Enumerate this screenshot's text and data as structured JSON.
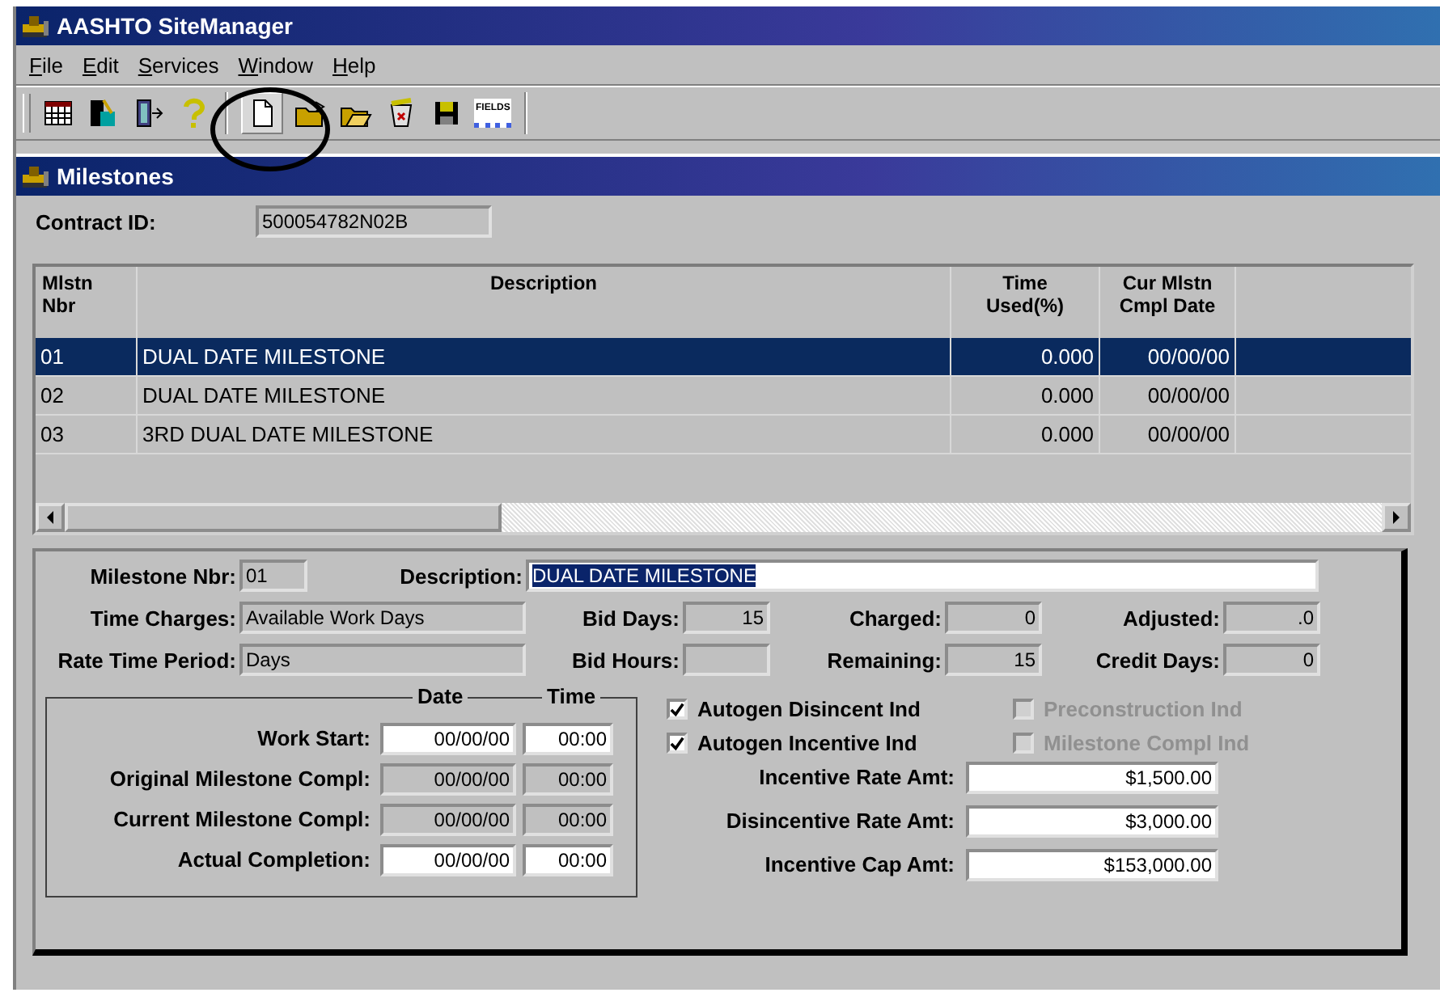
{
  "window": {
    "title": "AASHTO SiteManager"
  },
  "menu": [
    {
      "label": "File"
    },
    {
      "label": "Edit"
    },
    {
      "label": "Services"
    },
    {
      "label": "Window"
    },
    {
      "label": "Help"
    }
  ],
  "toolbar": {
    "fields_label": "FIELDS"
  },
  "child_window": {
    "title": "Milestones"
  },
  "contract": {
    "label": "Contract ID:",
    "value": "500054782N02B"
  },
  "table": {
    "columns": [
      {
        "label": "Mlstn\nNbr"
      },
      {
        "label": "Description"
      },
      {
        "label": "Time\nUsed(%)"
      },
      {
        "label": "Cur Mlstn\nCmpl Date"
      }
    ],
    "rows": [
      {
        "cells": [
          "01",
          "DUAL DATE MILESTONE",
          "0.000",
          "00/00/00"
        ],
        "selected": true
      },
      {
        "cells": [
          "02",
          "DUAL DATE MILESTONE",
          "0.000",
          "00/00/00"
        ],
        "selected": false
      },
      {
        "cells": [
          "03",
          "3RD DUAL DATE MILESTONE",
          "0.000",
          "00/00/00"
        ],
        "selected": false
      }
    ]
  },
  "detail": {
    "rows": [
      [
        {
          "label": "Milestone Nbr:",
          "value": "01",
          "editable": false
        },
        {
          "label": "Description:",
          "value": "DUAL DATE MILESTONE",
          "editable": true,
          "text_selected": true
        }
      ],
      [
        {
          "label": "Time Charges:",
          "value": "Available Work Days",
          "editable": false
        },
        {
          "label": "Bid Days:",
          "value": "15",
          "editable": false
        },
        {
          "label": "Charged:",
          "value": "0",
          "editable": false
        },
        {
          "label": "Adjusted:",
          "value": ".0",
          "editable": false
        }
      ],
      [
        {
          "label": "Rate Time Period:",
          "value": "Days",
          "editable": false
        },
        {
          "label": "Bid Hours:",
          "editable": false
        },
        {
          "label": "Remaining:",
          "value": "15",
          "editable": false
        },
        {
          "label": "Credit Days:",
          "value": "0",
          "editable": false
        }
      ]
    ],
    "dates": {
      "date_heading": "Date",
      "time_heading": "Time",
      "rows": [
        {
          "label": "Work Start:",
          "date": "00/00/00",
          "time": "00:00",
          "editable": true
        },
        {
          "label": "Original Milestone Compl:",
          "date": "00/00/00",
          "time": "00:00",
          "editable": false
        },
        {
          "label": "Current Milestone Compl:",
          "date": "00/00/00",
          "time": "00:00",
          "editable": false
        },
        {
          "label": "Actual Completion:",
          "date": "00/00/00",
          "time": "00:00",
          "editable": true
        }
      ]
    },
    "checkboxes": [
      {
        "label": "Autogen Disincent Ind",
        "checked": true,
        "disabled": false
      },
      {
        "label": "Preconstruction Ind",
        "checked": false,
        "disabled": true
      },
      {
        "label": "Autogen Incentive Ind",
        "checked": true,
        "disabled": false
      },
      {
        "label": "Milestone Compl Ind",
        "checked": false,
        "disabled": true
      }
    ],
    "amounts": [
      {
        "label": "Incentive Rate Amt:",
        "value": "$1,500.00"
      },
      {
        "label": "Disincentive Rate Amt:",
        "value": "$3,000.00"
      },
      {
        "label": "Incentive Cap Amt:",
        "value": "$153,000.00"
      }
    ]
  }
}
